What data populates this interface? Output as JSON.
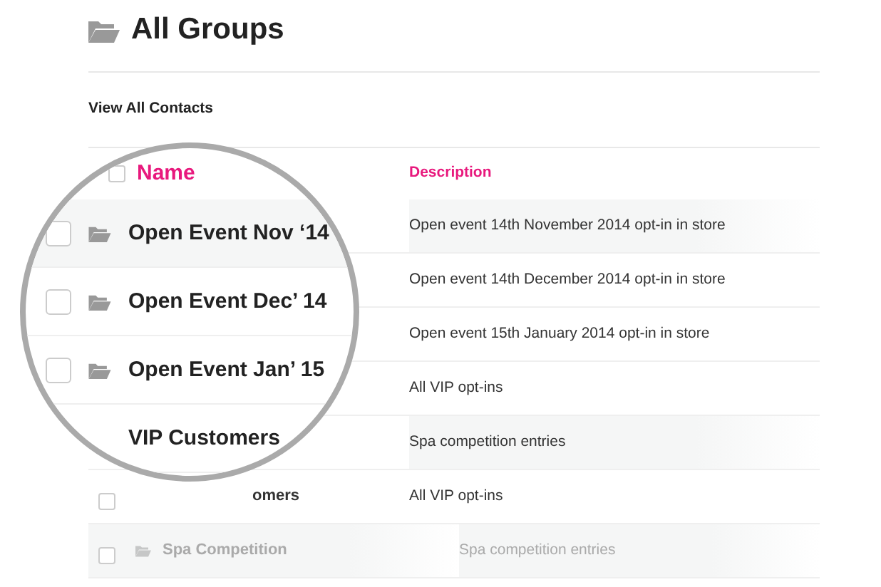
{
  "page": {
    "title": "All Groups",
    "link": "View All Contacts"
  },
  "table": {
    "headers": {
      "name": "Name",
      "description": "Description"
    },
    "header_checked": false,
    "rows": [
      {
        "highlighted": true,
        "dimmed": false,
        "description": "Open event 14th November 2014 opt-in in store"
      },
      {
        "highlighted": false,
        "dimmed": false,
        "description": "Open event 14th December 2014 opt-in in store"
      },
      {
        "highlighted": false,
        "dimmed": false,
        "description": "Open event 15th January 2014 opt-in in store"
      },
      {
        "highlighted": false,
        "dimmed": false,
        "description": "All VIP opt-ins"
      },
      {
        "highlighted": true,
        "dimmed": false,
        "description": "Spa competition entries"
      },
      {
        "checked": false,
        "kind": "cut",
        "highlighted": false,
        "dimmed": false,
        "name": "omers",
        "description": "All VIP opt-ins"
      },
      {
        "checked": false,
        "kind": "group",
        "highlighted": true,
        "dimmed": true,
        "name": "Spa Competition",
        "description": "Spa competition entries"
      }
    ]
  },
  "magnifier": {
    "rows": [
      {
        "checked": false,
        "highlighted": true,
        "name": "Open Event Nov ‘14"
      },
      {
        "checked": false,
        "highlighted": false,
        "name": "Open Event Dec’ 14"
      },
      {
        "checked": false,
        "highlighted": false,
        "name": "Open Event Jan’ 15"
      },
      {
        "highlighted": false,
        "name": "VIP Customers"
      }
    ]
  }
}
